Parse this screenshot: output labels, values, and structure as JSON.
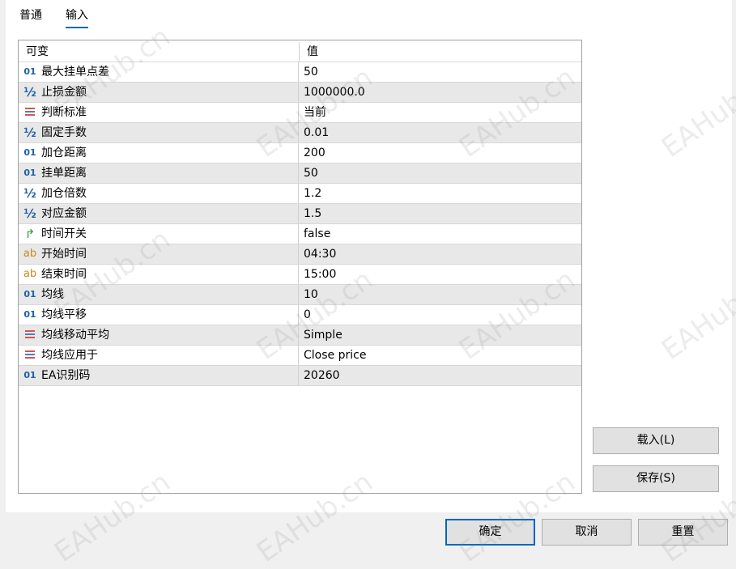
{
  "tabs": [
    {
      "label": "普通",
      "active": false
    },
    {
      "label": "输入",
      "active": true
    }
  ],
  "grid": {
    "header": {
      "name": "可变",
      "value": "值"
    },
    "rows": [
      {
        "type": "int",
        "name": "最大挂单点差",
        "value": "50"
      },
      {
        "type": "double",
        "name": "止损金额",
        "value": "1000000.0"
      },
      {
        "type": "enum",
        "name": "判断标准",
        "value": "当前"
      },
      {
        "type": "double",
        "name": "固定手数",
        "value": "0.01"
      },
      {
        "type": "int",
        "name": "加仓距离",
        "value": "200"
      },
      {
        "type": "int",
        "name": "挂单距离",
        "value": "50"
      },
      {
        "type": "double",
        "name": "加仓倍数",
        "value": "1.2"
      },
      {
        "type": "double",
        "name": "对应金额",
        "value": "1.5"
      },
      {
        "type": "bool",
        "name": "时间开关",
        "value": "false"
      },
      {
        "type": "string",
        "name": "开始时间",
        "value": "04:30"
      },
      {
        "type": "string",
        "name": "结束时间",
        "value": "15:00"
      },
      {
        "type": "int",
        "name": "均线",
        "value": "10"
      },
      {
        "type": "int",
        "name": "均线平移",
        "value": "0"
      },
      {
        "type": "enum",
        "name": "均线移动平均",
        "value": "Simple"
      },
      {
        "type": "enum",
        "name": "均线应用于",
        "value": "Close price"
      },
      {
        "type": "int",
        "name": "EA识别码",
        "value": "20260"
      }
    ]
  },
  "icons": {
    "int": {
      "name": "integer-type-icon",
      "glyph": "01"
    },
    "double": {
      "name": "double-type-icon",
      "glyph": "½"
    },
    "enum": {
      "name": "enum-type-icon",
      "glyph": ""
    },
    "bool": {
      "name": "bool-type-icon",
      "glyph": "↱"
    },
    "string": {
      "name": "string-type-icon",
      "glyph": "ab"
    }
  },
  "side_buttons": {
    "load": "载入(L)",
    "save": "保存(S)"
  },
  "bottom_buttons": {
    "ok": "确定",
    "cancel": "取消",
    "reset": "重置"
  },
  "watermark": "EAHub.cn",
  "colors": {
    "accent": "#0067c0",
    "row_alt": "#e8e8e8",
    "int_icon": "#1f5fa8",
    "string_icon": "#c88a1a",
    "bool_icon": "#2f9a3a",
    "enum_bar_red": "#d9534f",
    "enum_bar_blue": "#4a7fc1"
  }
}
